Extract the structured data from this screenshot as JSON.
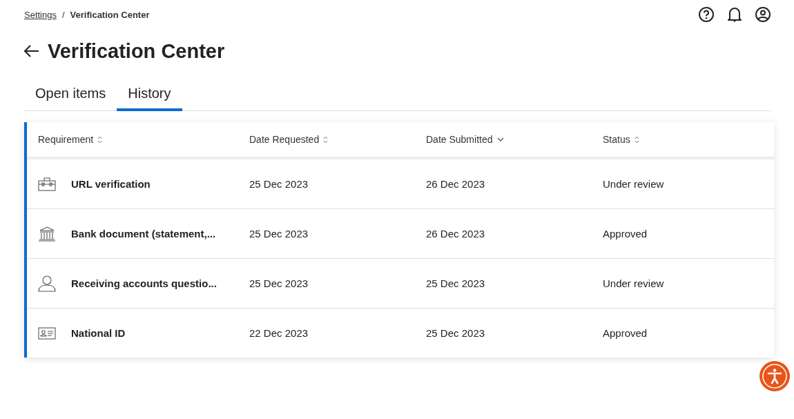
{
  "breadcrumb": [
    {
      "label": "Settings",
      "link": true
    },
    {
      "label": "Verification Center",
      "link": false
    }
  ],
  "separator": "/",
  "title": "Verification Center",
  "tabs": [
    {
      "label": "Open items",
      "selected": false
    },
    {
      "label": "History",
      "selected": true
    }
  ],
  "table": {
    "columns": [
      {
        "label": "Requirement",
        "sorted": false
      },
      {
        "label": "Date Requested",
        "sorted": false
      },
      {
        "label": "Date Submitted",
        "sorted": true
      },
      {
        "label": "Status",
        "sorted": false
      }
    ],
    "rows": [
      {
        "kind": "toolbox",
        "requirement": "URL verification",
        "requested": "25 Dec 2023",
        "submitted": "26 Dec 2023",
        "status": "Under review"
      },
      {
        "kind": "bank",
        "requirement": "Bank document (statement,...",
        "requested": "25 Dec 2023",
        "submitted": "26 Dec 2023",
        "status": "Approved"
      },
      {
        "kind": "person",
        "requirement": "Receiving accounts questio...",
        "requested": "25 Dec 2023",
        "submitted": "25 Dec 2023",
        "status": "Under review"
      },
      {
        "kind": "id",
        "requirement": "National ID",
        "requested": "22 Dec 2023",
        "submitted": "25 Dec 2023",
        "status": "Approved"
      }
    ]
  }
}
